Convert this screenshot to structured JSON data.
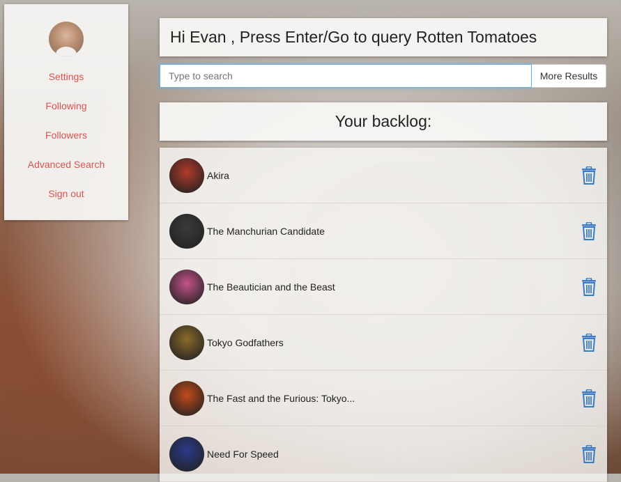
{
  "sidebar": {
    "items": [
      {
        "label": "Settings"
      },
      {
        "label": "Following"
      },
      {
        "label": "Followers"
      },
      {
        "label": "Advanced Search"
      },
      {
        "label": "Sign out"
      }
    ]
  },
  "header": {
    "greeting": "Hi Evan , Press Enter/Go to query Rotten Tomatoes"
  },
  "search": {
    "placeholder": "Type to search",
    "value": "",
    "more_label": "More Results"
  },
  "backlog": {
    "heading": "Your backlog:",
    "items": [
      {
        "title": "Akira",
        "poster_color": "#b23a2a"
      },
      {
        "title": "The Manchurian Candidate",
        "poster_color": "#3a3a3a"
      },
      {
        "title": "The Beautician and the Beast",
        "poster_color": "#c4538a"
      },
      {
        "title": "Tokyo Godfathers",
        "poster_color": "#8a6a2a"
      },
      {
        "title": "The Fast and the Furious: Tokyo...",
        "poster_color": "#c24a1a"
      },
      {
        "title": "Need For Speed",
        "poster_color": "#2a3a8a"
      }
    ]
  },
  "colors": {
    "link": "#d9534f",
    "trash": "#3a7bc8",
    "focus": "#66afe9"
  }
}
